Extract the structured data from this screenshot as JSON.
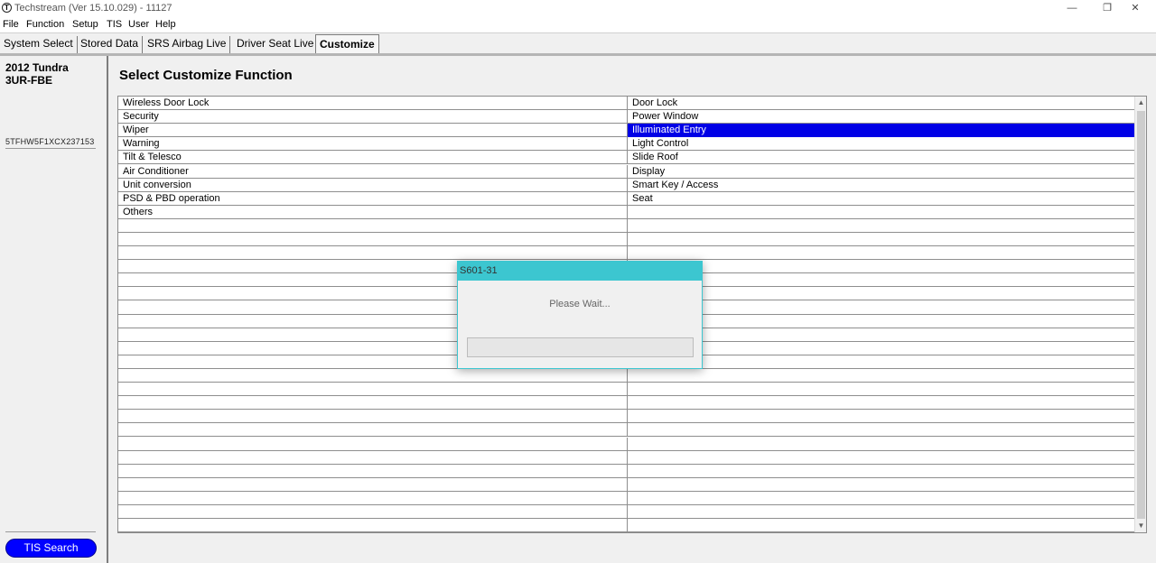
{
  "window": {
    "title": "Techstream (Ver 15.10.029) - 11127",
    "minimize_glyph": "—",
    "restore_glyph": "❐",
    "close_glyph": "✕"
  },
  "menu": [
    "File",
    "Function",
    "Setup",
    "TIS",
    "User",
    "Help"
  ],
  "tabs": [
    {
      "label": "System Select",
      "active": false
    },
    {
      "label": "Stored Data",
      "active": false
    },
    {
      "label": "SRS Airbag Live",
      "active": false
    },
    {
      "label": "Driver Seat Live",
      "active": false
    },
    {
      "label": "Customize",
      "active": true
    }
  ],
  "vehicle": {
    "model": "2012 Tundra",
    "engine": "3UR-FBE",
    "vin": "5TFHW5F1XCX237153"
  },
  "tis_search_label": "TIS Search",
  "main": {
    "title": "Select Customize Function",
    "left_items": [
      "Wireless Door Lock",
      "Security",
      "Wiper",
      "Warning",
      "Tilt & Telesco",
      "Air Conditioner",
      "Unit conversion",
      "PSD & PBD operation",
      "Others"
    ],
    "right_items": [
      "Door Lock",
      "Power Window",
      "Illuminated Entry",
      "Light Control",
      "Slide Roof",
      "Display",
      "Smart Key / Access",
      "Seat"
    ],
    "selected_right": "Illuminated Entry"
  },
  "dialog": {
    "title": "S601-31",
    "message": "Please Wait...",
    "progress": 0
  },
  "colors": {
    "selection": "#0000e6",
    "dialog_title": "#3cc6d0",
    "tis_button": "#0000ff"
  }
}
